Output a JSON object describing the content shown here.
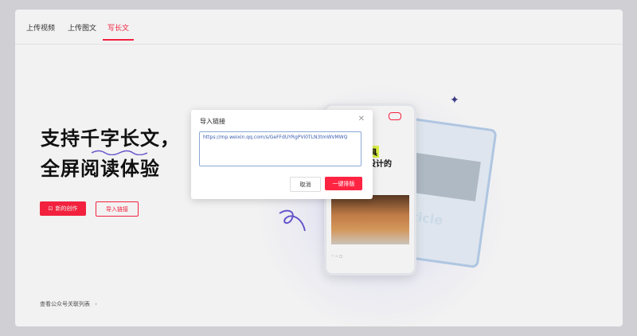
{
  "tabs": [
    {
      "label": "上传视频"
    },
    {
      "label": "上传图文"
    },
    {
      "label": "写长文"
    }
  ],
  "active_tab_index": 2,
  "hero": {
    "line1": "支持千字长文，",
    "line2": "全屏阅读体验"
  },
  "buttons": {
    "new_create": "新的创作",
    "import_link": "导入链接"
  },
  "footer_link": "查看公众号关联列表",
  "illustration": {
    "title1": "家具",
    "title2": "尚设计的",
    "back_word": "rticle"
  },
  "dialog": {
    "title": "导入链接",
    "input_value": "https://mp.weixin.qq.com/s/GeFFdUYRgPVi0TLN3tmWVMWQ",
    "cancel": "取消",
    "confirm": "一键排版"
  },
  "colors": {
    "accent": "#ff2442"
  }
}
